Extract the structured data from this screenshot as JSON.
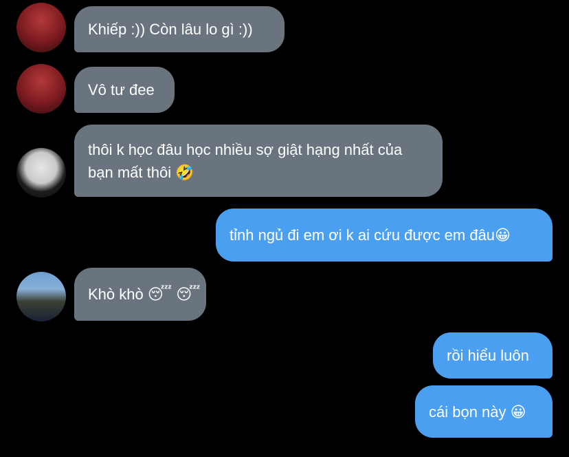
{
  "messages": [
    {
      "side": "received",
      "avatar": "red-jacket-avatar",
      "text": "Khiếp :)) Còn lâu lo gì :))"
    },
    {
      "side": "received",
      "avatar": "red-jacket-avatar",
      "text": "Vô tư đee"
    },
    {
      "side": "received",
      "avatar": "black-shirt-avatar",
      "text": "thôi k học đâu học nhiều sợ giật hạng nhất của bạn mất thôi 🤣"
    },
    {
      "side": "sent",
      "text": "tỉnh ngủ đi em ơi k ai cứu được em đâu😀"
    },
    {
      "side": "received",
      "avatar": "cap-avatar",
      "text": "Khò khò 😴 😴"
    },
    {
      "side": "sent",
      "text": "rồi hiểu luôn"
    },
    {
      "side": "sent",
      "text": "cái bọn này 😀"
    }
  ],
  "colors": {
    "background": "#000000",
    "received_bubble": "#69747f",
    "sent_bubble": "#4a9ff0",
    "text": "#ffffff"
  }
}
